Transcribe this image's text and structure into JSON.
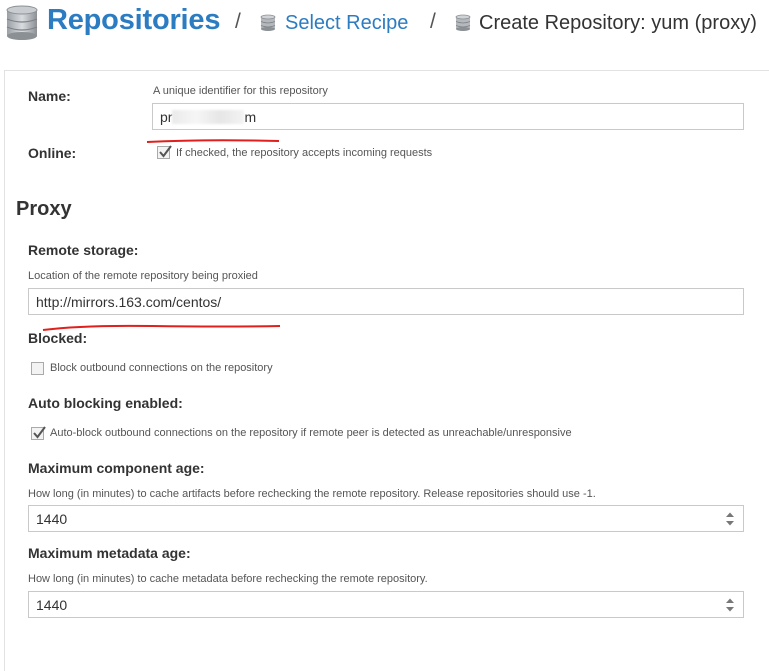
{
  "header": {
    "title": "Repositories",
    "crumb_sep": "/",
    "crumb_select_recipe": "Select Recipe",
    "crumb_create": "Create Repository: yum (proxy)"
  },
  "form": {
    "name": {
      "label": "Name:",
      "help": "A unique identifier for this repository",
      "value_start": "pr",
      "value_end": "m"
    },
    "online": {
      "label": "Online:",
      "help": "If checked, the repository accepts incoming requests",
      "checked": true
    },
    "proxy_section": "Proxy",
    "remote_storage": {
      "label": "Remote storage:",
      "help": "Location of the remote repository being proxied",
      "value": "http://mirrors.163.com/centos/"
    },
    "blocked": {
      "label": "Blocked:",
      "help": "Block outbound connections on the repository",
      "checked": false
    },
    "auto_blocking": {
      "label": "Auto blocking enabled:",
      "help": "Auto-block outbound connections on the repository if remote peer is detected as unreachable/unresponsive",
      "checked": true
    },
    "max_component_age": {
      "label": "Maximum component age:",
      "help": "How long (in minutes) to cache artifacts before rechecking the remote repository. Release repositories should use -1.",
      "value": "1440"
    },
    "max_metadata_age": {
      "label": "Maximum metadata age:",
      "help": "How long (in minutes) to cache metadata before rechecking the remote repository.",
      "value": "1440"
    }
  },
  "colors": {
    "accent": "#2c7cc2",
    "annotation_red": "#e0201c"
  },
  "icons": [
    "database-icon",
    "checkmark-icon",
    "spinner-arrows-icon"
  ]
}
